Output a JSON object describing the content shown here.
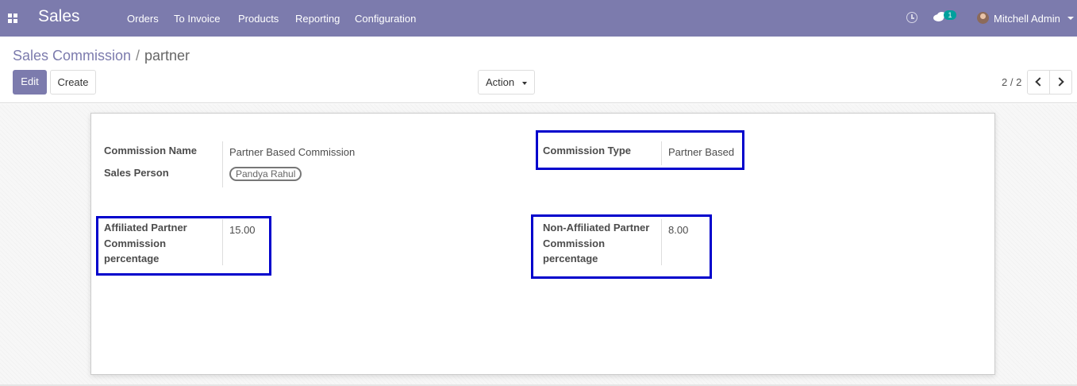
{
  "navbar": {
    "app_name": "Sales",
    "menu": [
      "Orders",
      "To Invoice",
      "Products",
      "Reporting",
      "Configuration"
    ],
    "messages_badge": "1",
    "user_name": "Mitchell Admin",
    "icons": {
      "apps": "apps-grid-icon",
      "activity": "clock-icon",
      "messages": "chat-icon"
    }
  },
  "breadcrumb": {
    "root": "Sales Commission",
    "separator": "/",
    "current": "partner"
  },
  "toolbar": {
    "edit_label": "Edit",
    "create_label": "Create",
    "action_label": "Action"
  },
  "pager": {
    "value": "2 / 2"
  },
  "form": {
    "commission_name_label": "Commission Name",
    "commission_name_value": "Partner Based Commission",
    "sales_person_label": "Sales Person",
    "sales_person_tag": "Pandya Rahul",
    "commission_type_label": "Commission Type",
    "commission_type_value": "Partner Based",
    "affiliated_label_lines": [
      "Affiliated Partner",
      "Commission",
      "percentage"
    ],
    "affiliated_value": "15.00",
    "non_affiliated_label_lines": [
      "Non-Affiliated Partner",
      "Commission",
      "percentage"
    ],
    "non_affiliated_value": "8.00"
  },
  "colors": {
    "navbar": "#7c7bad",
    "primary_button": "#7c7bad",
    "highlight_box": "#0000cc",
    "badge": "#00a09d"
  }
}
